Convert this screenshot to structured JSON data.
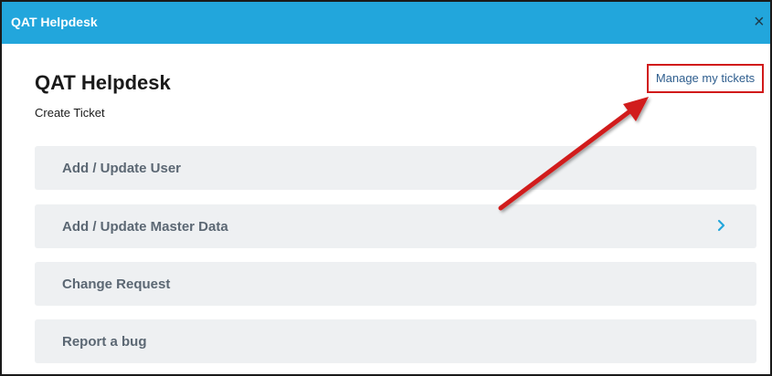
{
  "window": {
    "title": "QAT Helpdesk",
    "close_glyph": "×"
  },
  "page": {
    "title": "QAT Helpdesk",
    "subtitle": "Create Ticket",
    "manage_link": "Manage my tickets"
  },
  "menu": {
    "items": [
      {
        "label": "Add / Update User",
        "has_submenu": false
      },
      {
        "label": "Add / Update Master Data",
        "has_submenu": true
      },
      {
        "label": "Change Request",
        "has_submenu": false
      },
      {
        "label": "Report a bug",
        "has_submenu": false
      }
    ]
  },
  "colors": {
    "titlebar": "#22a6dc",
    "highlight": "#d11a1a",
    "link": "#2f5e8e",
    "item_bg": "#eef0f2",
    "chevron": "#22a6dc"
  },
  "icons": {
    "close": "close-icon",
    "chevron": "chevron-right-icon",
    "annotation": "red-arrow-annotation"
  }
}
